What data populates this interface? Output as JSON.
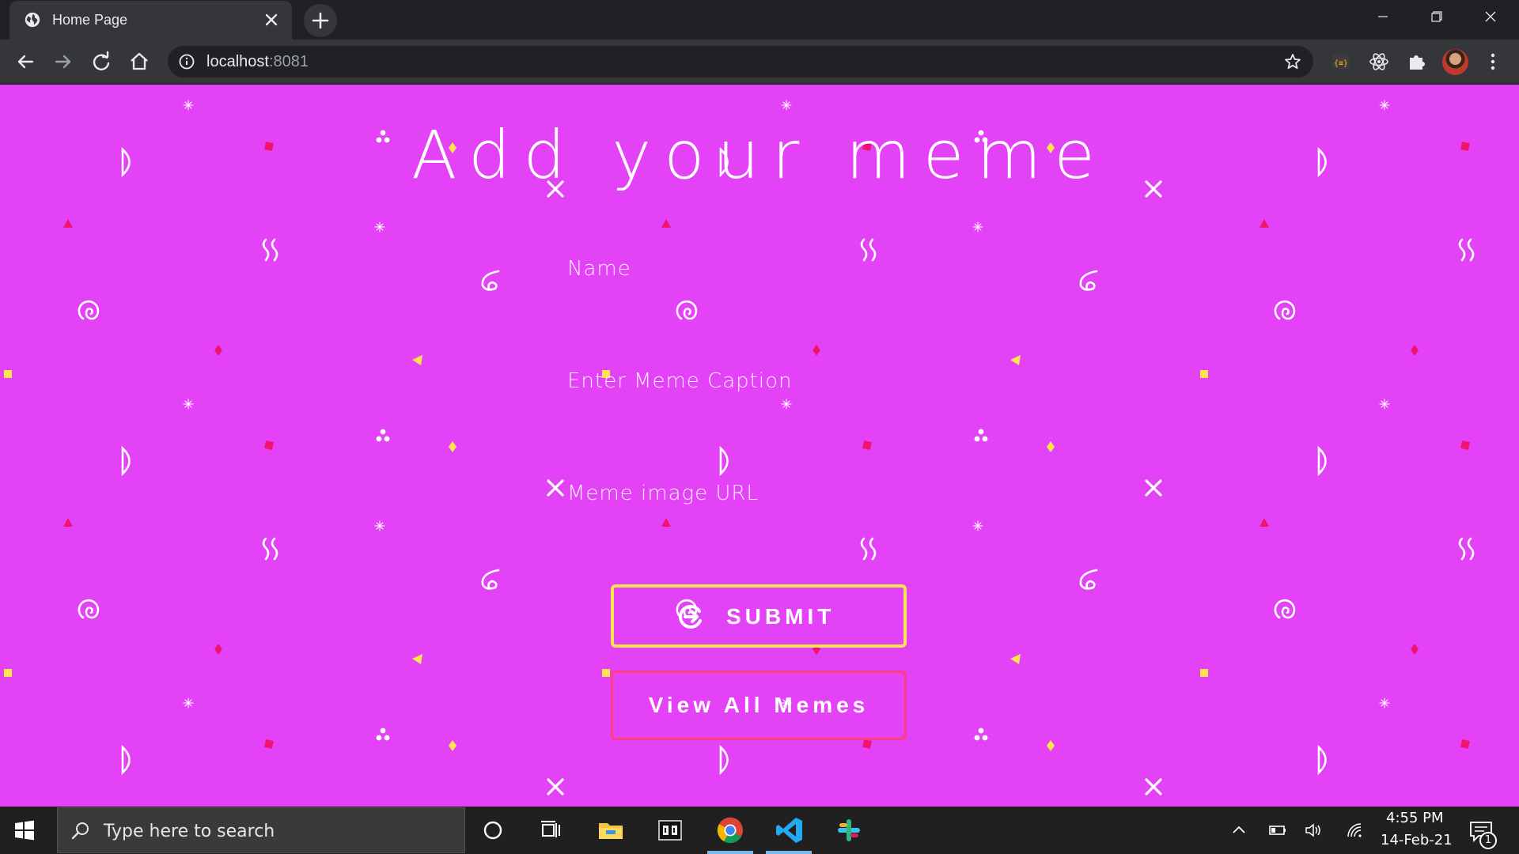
{
  "browser": {
    "tab_title": "Home Page",
    "url_host": "localhost",
    "url_port": ":8081"
  },
  "page": {
    "title": "Add your meme",
    "fields": {
      "name_placeholder": "Name",
      "caption_placeholder": "Enter Meme Caption",
      "url_placeholder": "Meme image URL"
    },
    "buttons": {
      "submit_label": "SUBMIT",
      "view_all_label": "View All Memes"
    },
    "colors": {
      "background": "#e442f7",
      "submit_border": "#ffe44d",
      "view_border": "#ff3d7f"
    }
  },
  "taskbar": {
    "search_placeholder": "Type here to search",
    "time": "4:55 PM",
    "date": "14-Feb-21",
    "notification_count": "1"
  }
}
